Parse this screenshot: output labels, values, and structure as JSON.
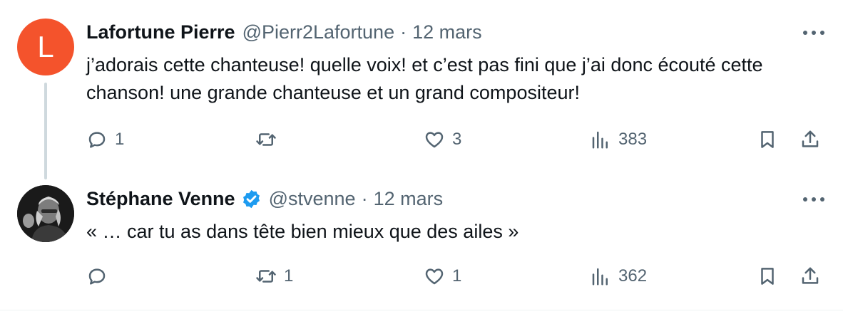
{
  "tweets": [
    {
      "avatar_letter": "L",
      "avatar_color": "#f4532c",
      "name": "Lafortune Pierre",
      "handle": "@Pierr2Lafortune",
      "separator": "·",
      "date": "12 mars",
      "text": "j’adorais cette chanteuse! quelle voix! et c’est pas fini que j’ai donc écouté cette chanson! une grande chanteuse et un grand compositeur!",
      "verified": false,
      "replies": "1",
      "reposts": "",
      "likes": "3",
      "views": "383"
    },
    {
      "avatar_image": "photo-avatar",
      "name": "Stéphane Venne",
      "handle": "@stvenne",
      "separator": "·",
      "date": "12 mars",
      "text": "« … car tu as dans tête bien mieux que des ailes »",
      "verified": true,
      "verified_color": "#1d9bf0",
      "replies": "",
      "reposts": "1",
      "likes": "1",
      "views": "362"
    }
  ],
  "colors": {
    "text": "#0f1419",
    "secondary": "#536471",
    "thread_line": "#cfd9de"
  }
}
